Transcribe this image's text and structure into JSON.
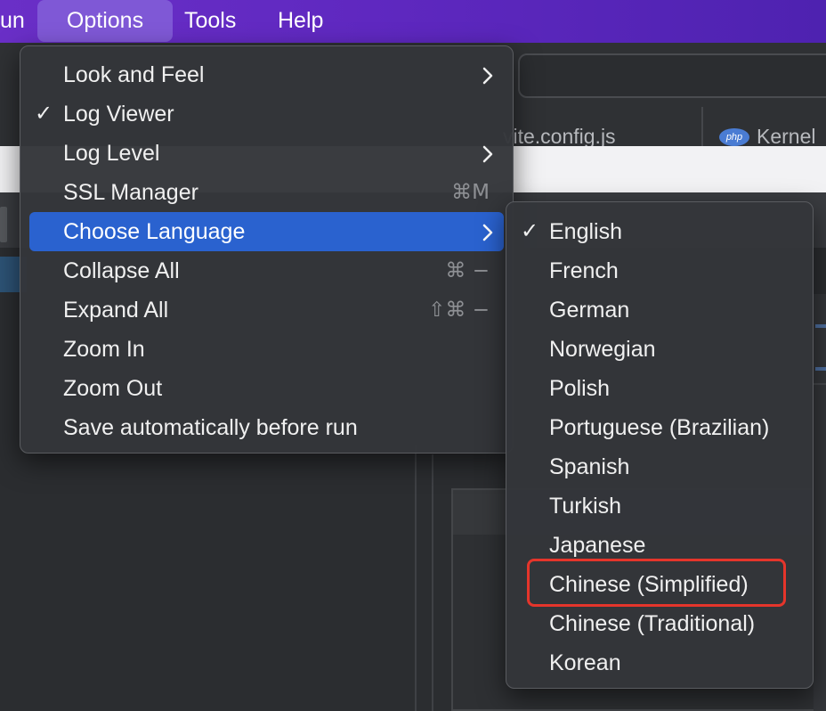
{
  "menubar": {
    "run_partial": "un",
    "options": "Options",
    "tools": "Tools",
    "help": "Help"
  },
  "background": {
    "tab_vite": "vite.config.js",
    "tab_kernel": "Kernel",
    "php_badge": "php"
  },
  "options_menu": {
    "items": [
      {
        "label": "Look and Feel",
        "submenu": true
      },
      {
        "label": "Log Viewer",
        "checked": true
      },
      {
        "label": "Log Level",
        "submenu": true
      },
      {
        "label": "SSL Manager",
        "shortcut": "⌘M"
      },
      {
        "label": "Choose Language",
        "submenu": true,
        "selected": true
      },
      {
        "label": "Collapse All",
        "shortcut": "⌘ −"
      },
      {
        "label": "Expand All",
        "shortcut": "⇧⌘ −"
      },
      {
        "label": "Zoom In"
      },
      {
        "label": "Zoom Out"
      },
      {
        "label": "Save automatically before run"
      }
    ],
    "check_glyph": "✓"
  },
  "language_menu": {
    "items": [
      {
        "label": "English",
        "checked": true
      },
      {
        "label": "French"
      },
      {
        "label": "German"
      },
      {
        "label": "Norwegian"
      },
      {
        "label": "Polish"
      },
      {
        "label": "Portuguese (Brazilian)"
      },
      {
        "label": "Spanish"
      },
      {
        "label": "Turkish"
      },
      {
        "label": "Japanese"
      },
      {
        "label": "Chinese (Simplified)",
        "highlighted": true
      },
      {
        "label": "Chinese (Traditional)"
      },
      {
        "label": "Korean"
      }
    ],
    "check_glyph": "✓"
  },
  "colors": {
    "menubar_gradient_start": "#6a2fc7",
    "selection_blue": "#2a62cf",
    "highlight_red": "#e5352b"
  }
}
